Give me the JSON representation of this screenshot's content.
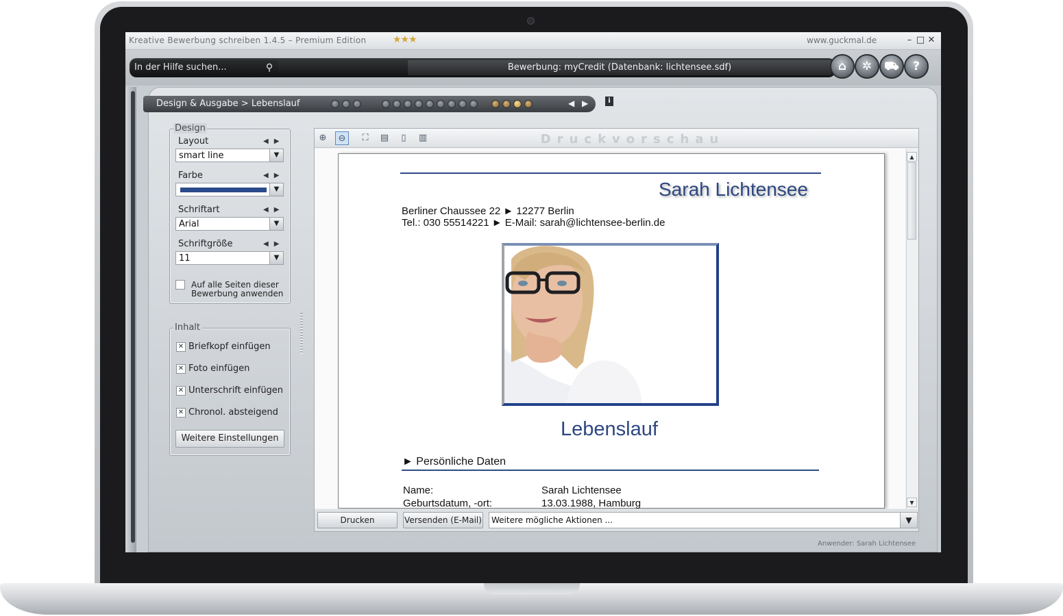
{
  "window": {
    "title": "Kreative Bewerbung schreiben 1.4.5   –   Premium Edition",
    "stars": "★★★",
    "website": "www.guckmal.de",
    "controls": [
      "–",
      "□",
      "✕"
    ]
  },
  "topbar": {
    "search_placeholder": "In der Hilfe suchen...",
    "database_info": "Bewerbung: myCredit (Datenbank: lichtensee.sdf)",
    "buttons": [
      "home-icon",
      "settings-icon",
      "cart-icon",
      "help-icon"
    ],
    "help_glyph": "?"
  },
  "breadcrumb": "Design & Ausgabe > Lebenslauf",
  "design": {
    "legend": "Design",
    "layout_label": "Layout",
    "layout_value": "smart line",
    "color_label": "Farbe",
    "color_value": "#2b4a8b",
    "font_label": "Schriftart",
    "font_value": "Arial",
    "size_label": "Schriftgröße",
    "size_value": "11",
    "apply_all_label_1": "Auf alle Seiten dieser",
    "apply_all_label_2": "Bewerbung anwenden",
    "apply_all_checked": false
  },
  "content": {
    "legend": "Inhalt",
    "options": [
      {
        "label": "Briefkopf einfügen",
        "checked": true
      },
      {
        "label": "Foto einfügen",
        "checked": true
      },
      {
        "label": "Unterschrift einfügen",
        "checked": true
      },
      {
        "label": "Chronol. absteigend",
        "checked": true
      }
    ],
    "more_button": "Weitere Einstellungen"
  },
  "preview": {
    "title": "Druckvorschau",
    "tools": [
      "zoom-in-icon",
      "zoom-out-icon",
      "fit-page-icon",
      "fit-width-icon",
      "single-page-icon",
      "two-page-icon"
    ],
    "document": {
      "name": "Sarah Lichtensee",
      "address": "Berliner Chaussee 22  ►  12277 Berlin",
      "contact": "Tel.: 030 55514221  ►  E-Mail: sarah@lichtensee-berlin.de",
      "heading": "Lebenslauf",
      "section": "► Persönliche Daten",
      "rows": [
        {
          "label": "Name:",
          "value": "Sarah Lichtensee"
        },
        {
          "label": "Geburtsdatum, -ort:",
          "value": "13.03.1988, Hamburg"
        }
      ]
    }
  },
  "actions": {
    "print": "Drucken",
    "send": "Versenden (E-Mail)",
    "more": "Weitere mögliche Aktionen ..."
  },
  "status": {
    "user": "Anwender: Sarah Lichtensee"
  }
}
